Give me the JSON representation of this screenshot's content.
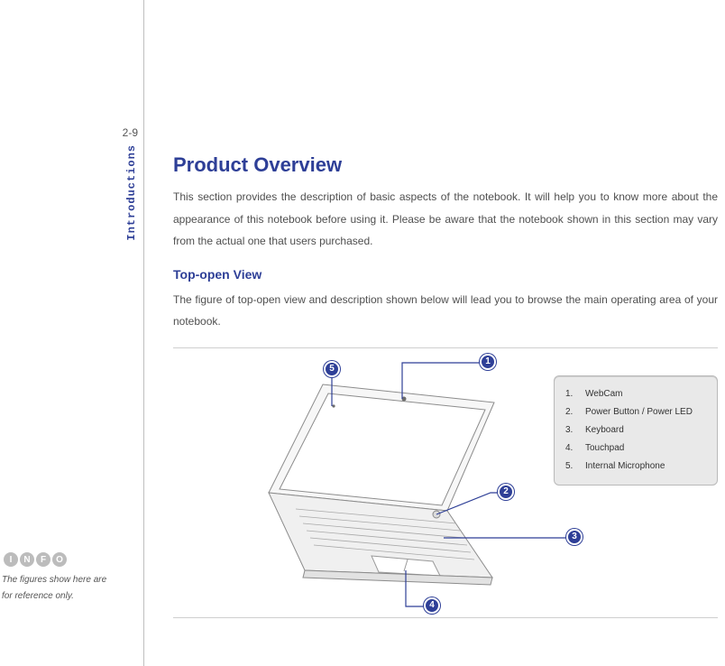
{
  "page_number": "2-9",
  "section_tab": "Introductions",
  "info_badge": [
    "I",
    "N",
    "F",
    "O"
  ],
  "footnote_line1": "The figures show here are",
  "footnote_line2": "for reference only.",
  "heading1": "Product Overview",
  "para1": "This section provides the description of basic aspects of the notebook.   It will help you to know more about the appearance of this notebook before using it. Please be aware that the notebook shown in this section may vary from the actual one that users purchased.",
  "heading2": "Top-open View",
  "para2": "The figure of top-open view and description shown below will lead you to browse the main operating area of your notebook.",
  "callouts": {
    "c1": "1",
    "c2": "2",
    "c3": "3",
    "c4": "4",
    "c5": "5"
  },
  "legend": [
    {
      "n": "1.",
      "label": "WebCam"
    },
    {
      "n": "2.",
      "label": "Power Button / Power LED"
    },
    {
      "n": "3.",
      "label": "Keyboard"
    },
    {
      "n": "4.",
      "label": "Touchpad"
    },
    {
      "n": "5.",
      "label": "Internal Microphone"
    }
  ]
}
